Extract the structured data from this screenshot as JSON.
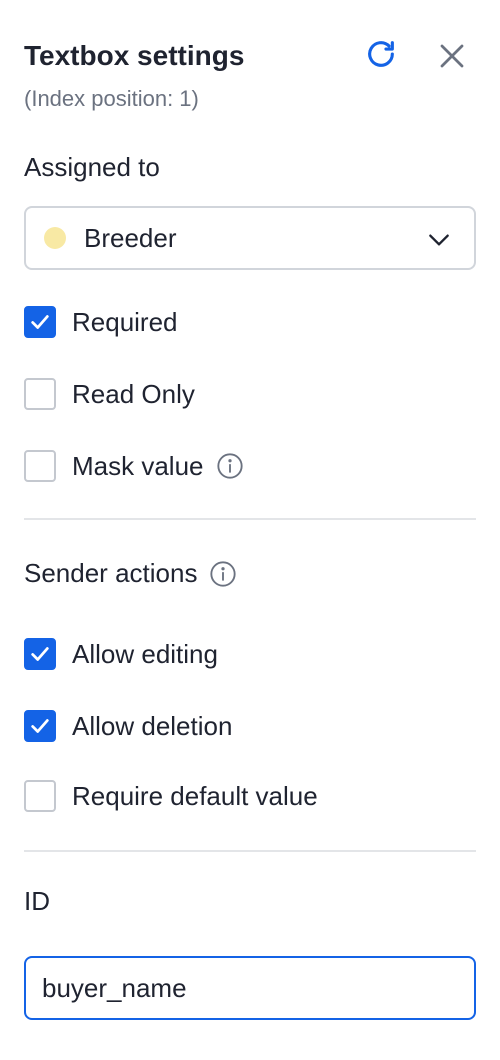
{
  "header": {
    "title": "Textbox settings",
    "subtitle": "(Index position: 1)"
  },
  "assigned": {
    "label": "Assigned to",
    "selected": "Breeder",
    "dot_color": "#f8e9a4"
  },
  "options": {
    "required": {
      "label": "Required",
      "checked": true
    },
    "read_only": {
      "label": "Read Only",
      "checked": false
    },
    "mask_value": {
      "label": "Mask value",
      "checked": false
    }
  },
  "sender_actions": {
    "label": "Sender actions",
    "allow_editing": {
      "label": "Allow editing",
      "checked": true
    },
    "allow_deletion": {
      "label": "Allow deletion",
      "checked": true
    },
    "require_default": {
      "label": "Require default value",
      "checked": false
    }
  },
  "id_field": {
    "label": "ID",
    "value": "buyer_name"
  },
  "colors": {
    "accent": "#1463e6",
    "text": "#1f2330",
    "muted": "#6b7280"
  }
}
